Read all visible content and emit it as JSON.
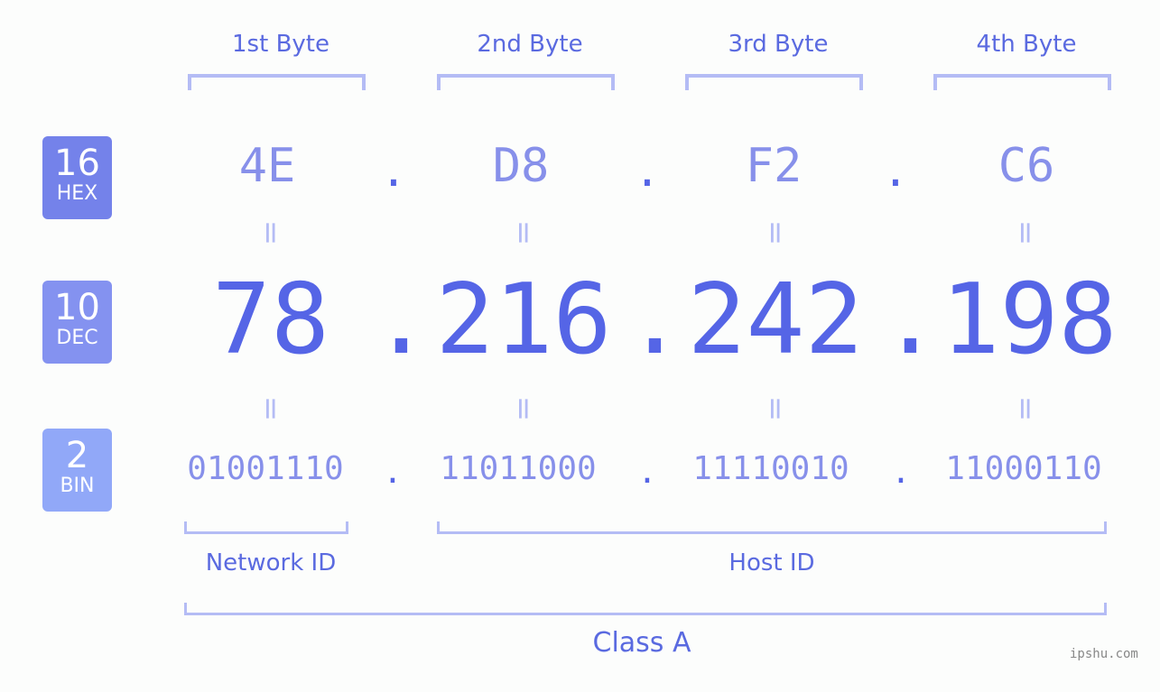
{
  "bytes": {
    "headers": [
      "1st Byte",
      "2nd Byte",
      "3rd Byte",
      "4th Byte"
    ],
    "hex": [
      "4E",
      "D8",
      "F2",
      "C6"
    ],
    "dec": [
      "78",
      "216",
      "242",
      "198"
    ],
    "bin": [
      "01001110",
      "11011000",
      "11110010",
      "11000110"
    ],
    "separator": ".",
    "equals": "="
  },
  "badges": [
    {
      "base": "16",
      "label": "HEX",
      "color": "#7482ea"
    },
    {
      "base": "10",
      "label": "DEC",
      "color": "#8492f0"
    },
    {
      "base": "2",
      "label": "BIN",
      "color": "#91a8f8"
    }
  ],
  "sections": {
    "network": "Network ID",
    "host": "Host ID",
    "class": "Class A"
  },
  "watermark": "ipshu.com"
}
